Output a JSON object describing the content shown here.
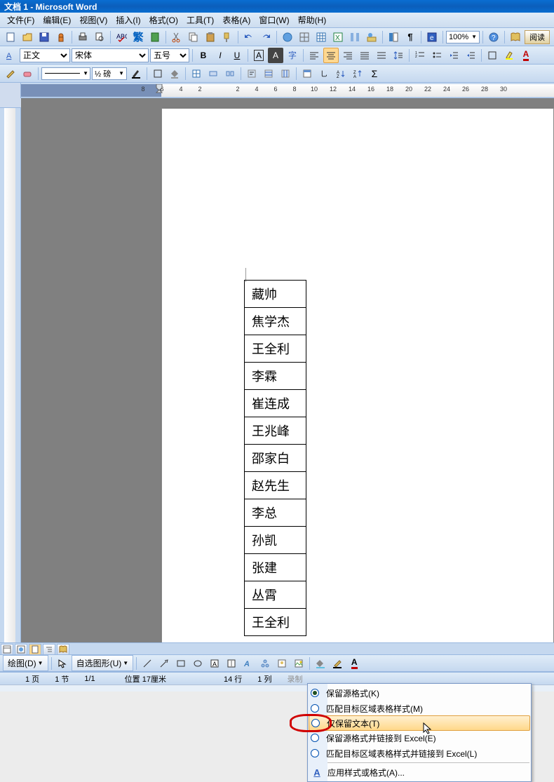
{
  "window": {
    "title": "文档 1 - Microsoft Word"
  },
  "menu": {
    "file": "文件(F)",
    "edit": "编辑(E)",
    "view": "视图(V)",
    "insert": "插入(I)",
    "format": "格式(O)",
    "tools": "工具(T)",
    "table": "表格(A)",
    "window": "窗口(W)",
    "help": "帮助(H)"
  },
  "toolbar": {
    "zoom": "100%",
    "read_label": "阅读",
    "style": "正文",
    "font": "宋体",
    "size": "五号",
    "indent_label": "½ 磅"
  },
  "ruler": {
    "nums": [
      "8",
      "6",
      "4",
      "2",
      "",
      "2",
      "4",
      "6",
      "8",
      "10",
      "12",
      "14",
      "16",
      "18",
      "20",
      "22",
      "24",
      "26",
      "28",
      "30"
    ]
  },
  "table_data": [
    "藏帅",
    "焦学杰",
    "王全利",
    "李霖",
    "崔连成",
    "王兆峰",
    "邵家白",
    "赵先生",
    "李总",
    "孙凯",
    "张建",
    "丛霄",
    "王全利"
  ],
  "paste_options": {
    "opt1": "保留源格式(K)",
    "opt2": "匹配目标区域表格样式(M)",
    "opt3": "仅保留文本(T)",
    "opt4": "保留源格式并链接到 Excel(E)",
    "opt5": "匹配目标区域表格样式并链接到 Excel(L)",
    "opt6": "应用样式或格式(A)..."
  },
  "drawbar": {
    "draw": "绘图(D)",
    "autoshape": "自选图形(U)"
  },
  "status": {
    "page": "1 页",
    "section": "1 节",
    "pages": "1/1",
    "position": "位置 17厘米",
    "line": "14 行",
    "col": "1 列",
    "rec": "录制"
  }
}
